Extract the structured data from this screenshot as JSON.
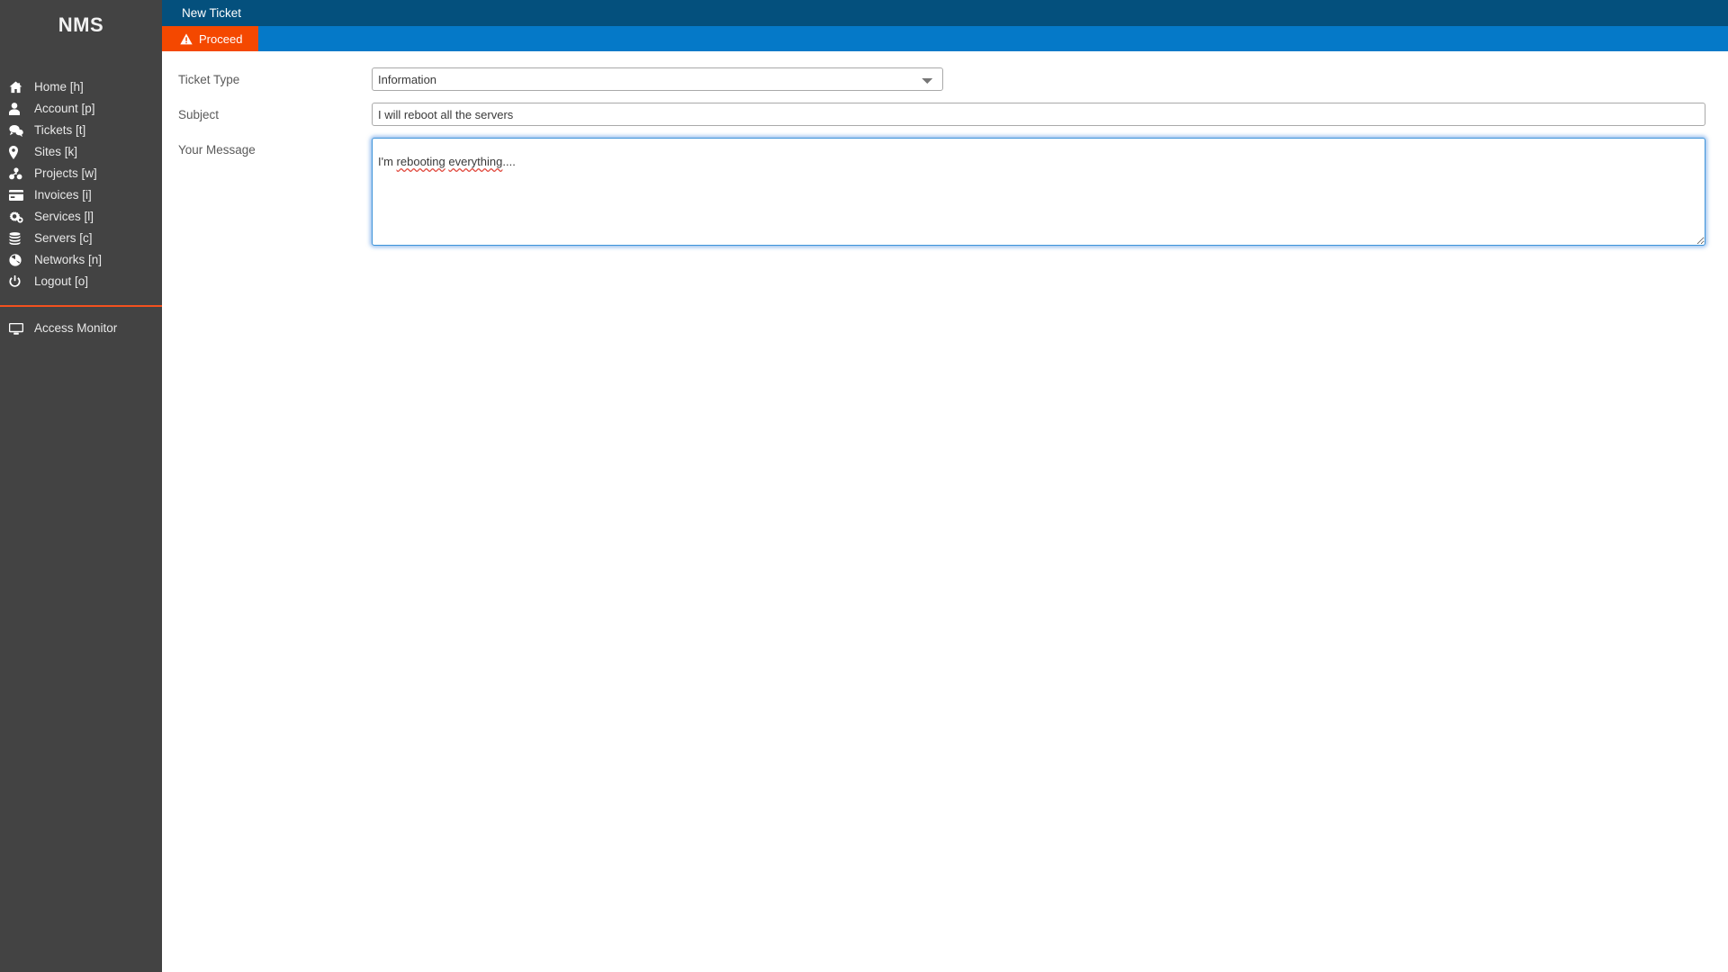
{
  "sidebar": {
    "brand": "NMS",
    "primary_items": [
      {
        "label": "Home [h]",
        "icon": "home-icon"
      },
      {
        "label": "Account [p]",
        "icon": "user-icon"
      },
      {
        "label": "Tickets [t]",
        "icon": "comments-icon"
      },
      {
        "label": "Sites [k]",
        "icon": "map-marker-icon"
      },
      {
        "label": "Projects [w]",
        "icon": "projects-icon"
      },
      {
        "label": "Invoices [i]",
        "icon": "credit-card-icon"
      },
      {
        "label": "Services [l]",
        "icon": "cogs-icon"
      },
      {
        "label": "Servers [c]",
        "icon": "database-icon"
      },
      {
        "label": "Networks [n]",
        "icon": "globe-icon"
      },
      {
        "label": "Logout [o]",
        "icon": "power-icon"
      }
    ],
    "secondary_items": [
      {
        "label": "Access Monitor",
        "icon": "monitor-icon"
      }
    ],
    "divider_color": "#f4511e",
    "background_color": "#434343"
  },
  "header": {
    "title": "New Ticket",
    "background_color": "#04507d"
  },
  "toolbar": {
    "proceed_label": "Proceed",
    "proceed_icon": "warning-triangle-icon",
    "proceed_color": "#f44800",
    "background_color": "#0579c8"
  },
  "form": {
    "ticket_type": {
      "label": "Ticket Type",
      "value": "Information",
      "options": [
        "Information"
      ]
    },
    "subject": {
      "label": "Subject",
      "value": "I will reboot all the servers",
      "placeholder": ""
    },
    "message": {
      "label": "Your Message",
      "value": "I'm rebooting everything....",
      "placeholder": "",
      "spellcheck_words": [
        "rebooting",
        "everything"
      ],
      "text_before": "I'm ",
      "word_one": "rebooting",
      "gap": " ",
      "word_two": "everything",
      "text_after": "...."
    }
  }
}
